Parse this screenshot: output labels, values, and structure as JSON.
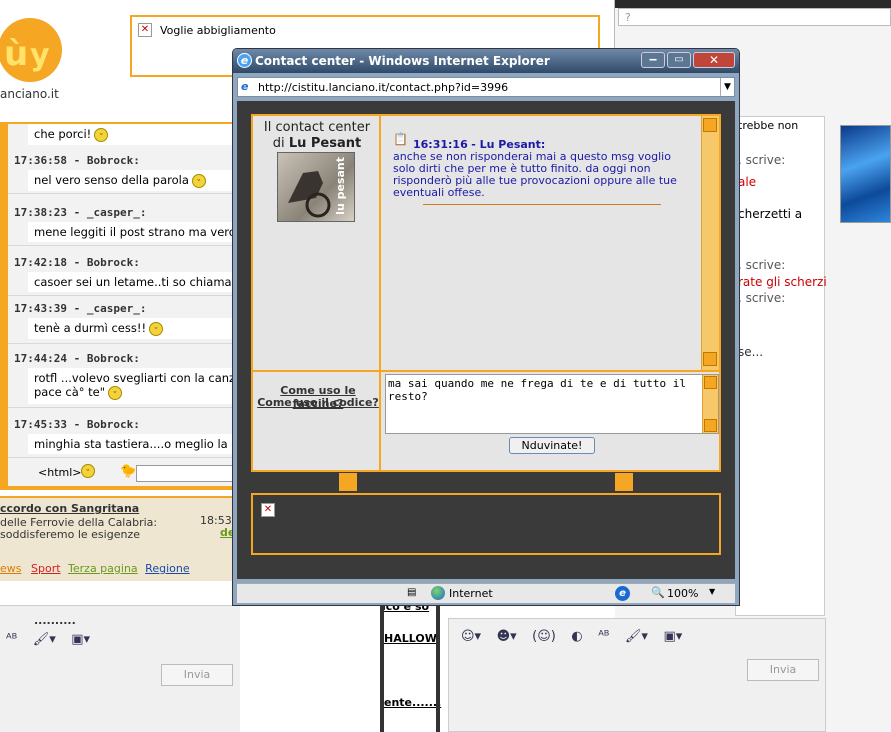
{
  "background_page": {
    "logo_domain": "anciano.it",
    "ad_title": "Voglie abbigliamento",
    "chat_messages": [
      {
        "meta": "",
        "text": "che porci!"
      },
      {
        "meta": "17:36:58 - Bobrock:",
        "text": "nel vero senso della parola"
      },
      {
        "meta": "17:38:23 - _casper_:",
        "text": "mene leggiti il post strano ma vero"
      },
      {
        "meta": "17:42:18 - Bobrock:",
        "text": "casoer sei un letame..ti so chiamat"
      },
      {
        "meta": "17:43:39 - _casper_:",
        "text": "tenè a durmì cess!!"
      },
      {
        "meta": "17:44:24 - Bobrock:",
        "text": "rotfl ...volevo svegliarti con la canz",
        "text2": "pace cà° te\""
      },
      {
        "meta": "17:45:33 - Bobrock:",
        "text": "minghia sta tastiera....o meglio la"
      }
    ],
    "html_label": "<html>",
    "news": {
      "headline": "ccordo con Sangritana",
      "time": "18:53",
      "line1": "delle Ferrovie della Calabria:",
      "line2": "soddisferemo le esigenze",
      "more": "de",
      "links": [
        "ews",
        "Sport",
        "Terza pagina",
        "Regione"
      ]
    },
    "dots": "..........",
    "invia_label": "Invia",
    "right_texts": [
      "trebbe non",
      ". scrive:",
      "ale",
      "cherzetti a",
      ". scrive:",
      "rate gli scherzi",
      ". scrive:",
      "se..."
    ],
    "mid_texts": [
      "ico e so",
      "HALLOW",
      "ente......."
    ],
    "right_dots": ".........",
    "right_invia_label": "Invia",
    "qmark": "?"
  },
  "window": {
    "title": "Contact center - Windows Internet Explorer",
    "url": "http://cistitu.lanciano.it/contact.php?id=3996",
    "contact_center_label": "Il contact center",
    "di_label": "di",
    "user_name": "Lu Pesant",
    "avatar_caption": "lu pesant",
    "message": {
      "time": "16:31:16",
      "author": "Lu Pesant:",
      "body": "anche se non risponderai mai a questo msg voglio solo dirti che per me è tutto finito. da oggi non risponderò più alle tue provocazioni oppure alle tue eventuali offese."
    },
    "help_link_1": "Come uso le faccine?",
    "help_link_2": "Come uso il codice?",
    "input_text": "ma sai quando me ne frega di te e di tutto il resto?",
    "send_button": "Nduvinate!",
    "status_zone": "Internet",
    "zoom": "100%"
  },
  "colors": {
    "accent_orange": "#f5a623",
    "message_blue": "#1a1aa6",
    "link_blue": "#1a4aa6",
    "titlebar": "#3d5a7a"
  }
}
